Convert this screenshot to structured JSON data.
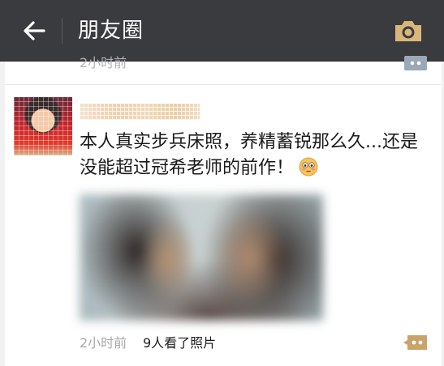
{
  "header": {
    "title": "朋友圈",
    "back_icon": "arrow-left-icon",
    "camera_icon": "camera-icon",
    "accent": "#d9b77a",
    "bar_color": "#3a3b3f"
  },
  "previous_post": {
    "time": "2小时前",
    "comment_icon": "comment-bubble-icon"
  },
  "post": {
    "text": "本人真实步兵床照，养精蓄锐那么久...还是没能超过冠希老师的前作！",
    "emoji_icon": "flushed-face-emoji",
    "time": "2小时前",
    "views": "9人看了照片",
    "comment_icon": "comment-bubble-icon",
    "comment_color": "#c9a46a"
  }
}
